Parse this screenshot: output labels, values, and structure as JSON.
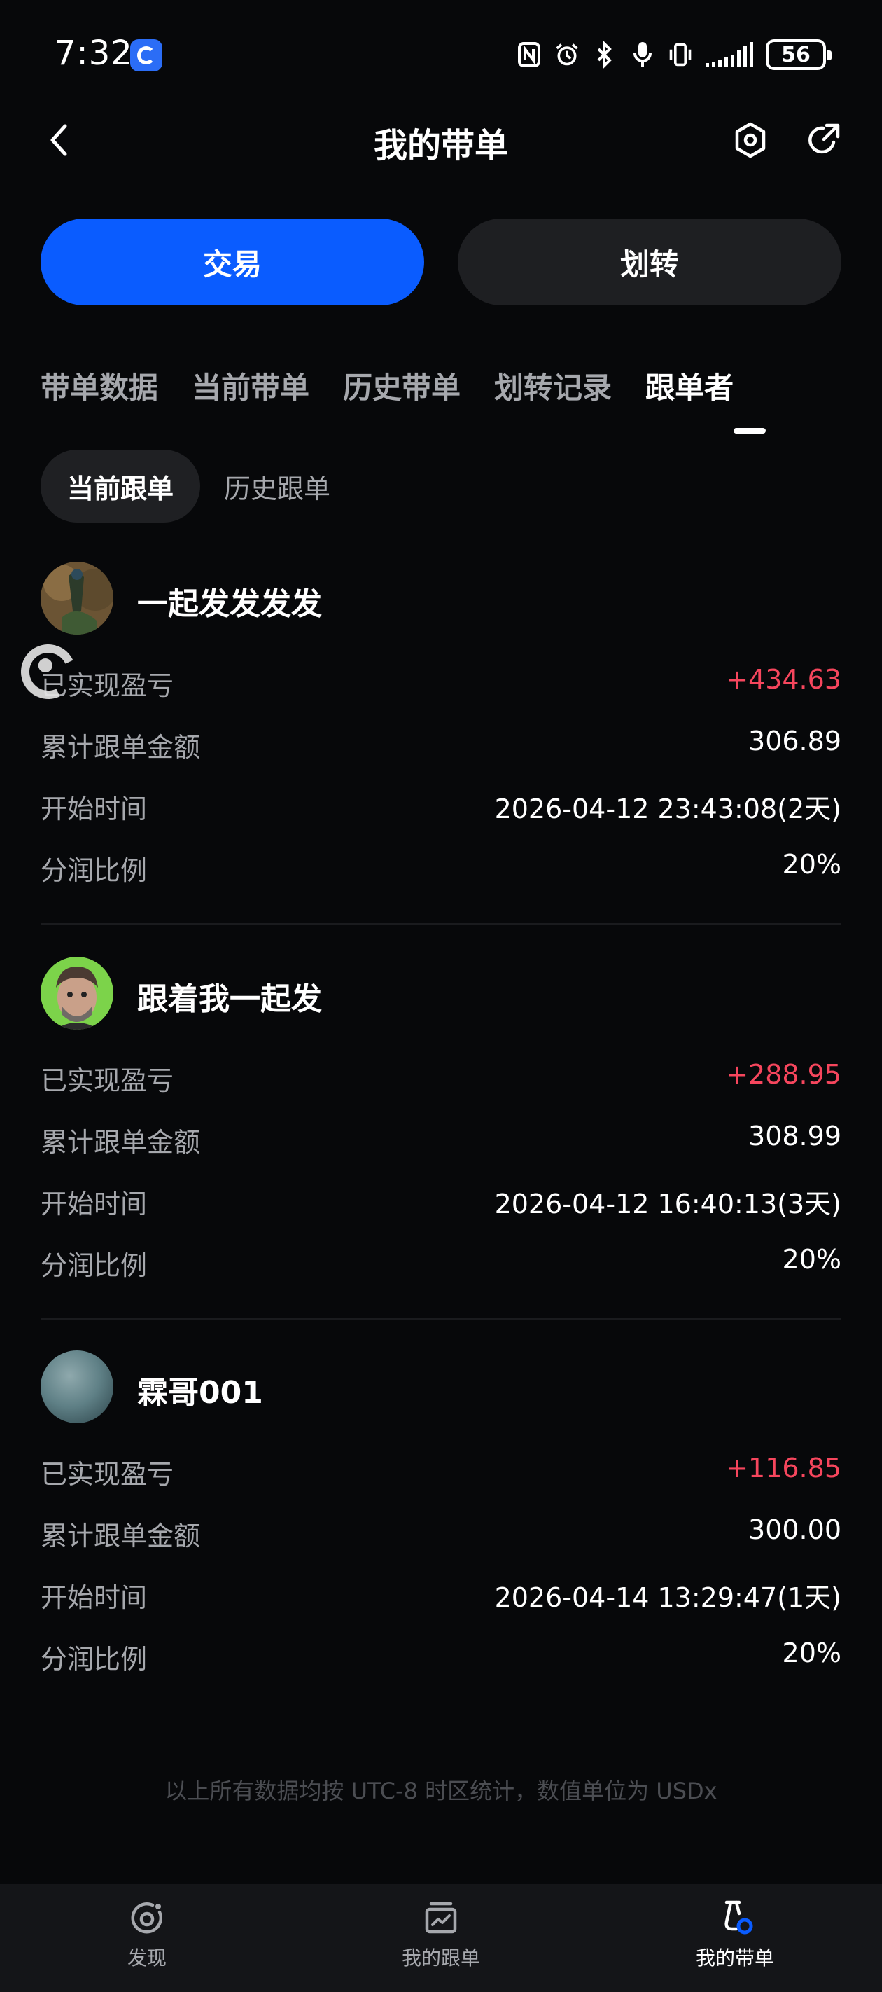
{
  "status_bar": {
    "time": "7:32",
    "battery": "56"
  },
  "header": {
    "title": "我的带单"
  },
  "actions": {
    "trade_label": "交易",
    "transfer_label": "划转"
  },
  "tabs": [
    {
      "label": "带单数据"
    },
    {
      "label": "当前带单"
    },
    {
      "label": "历史带单"
    },
    {
      "label": "划转记录"
    },
    {
      "label": "跟单者"
    }
  ],
  "subtabs": {
    "current": "当前跟单",
    "history": "历史跟单"
  },
  "followers": [
    {
      "name": "一起发发发发",
      "realized_pnl_label": "已实现盈亏",
      "realized_pnl": "+434.63",
      "total_amount_label": "累计跟单金额",
      "total_amount": "306.89",
      "start_time_label": "开始时间",
      "start_time": "2026-04-12 23:43:08(2天)",
      "share_ratio_label": "分润比例",
      "share_ratio": "20%"
    },
    {
      "name": "跟着我一起发",
      "realized_pnl_label": "已实现盈亏",
      "realized_pnl": "+288.95",
      "total_amount_label": "累计跟单金额",
      "total_amount": "308.99",
      "start_time_label": "开始时间",
      "start_time": "2026-04-12 16:40:13(3天)",
      "share_ratio_label": "分润比例",
      "share_ratio": "20%"
    },
    {
      "name": "霖哥001",
      "realized_pnl_label": "已实现盈亏",
      "realized_pnl": "+116.85",
      "total_amount_label": "累计跟单金额",
      "total_amount": "300.00",
      "start_time_label": "开始时间",
      "start_time": "2026-04-14 13:29:47(1天)",
      "share_ratio_label": "分润比例",
      "share_ratio": "20%"
    }
  ],
  "footnote": "以上所有数据均按 UTC-8 时区统计，数值单位为 USDx",
  "bottom_nav": [
    {
      "label": "发现",
      "icon": "discover-icon"
    },
    {
      "label": "我的跟单",
      "icon": "copy-trade-icon"
    },
    {
      "label": "我的带单",
      "icon": "lead-trade-icon"
    }
  ],
  "colors": {
    "accent": "#0a5cff",
    "profit": "#f6465d",
    "background": "#07080a"
  }
}
